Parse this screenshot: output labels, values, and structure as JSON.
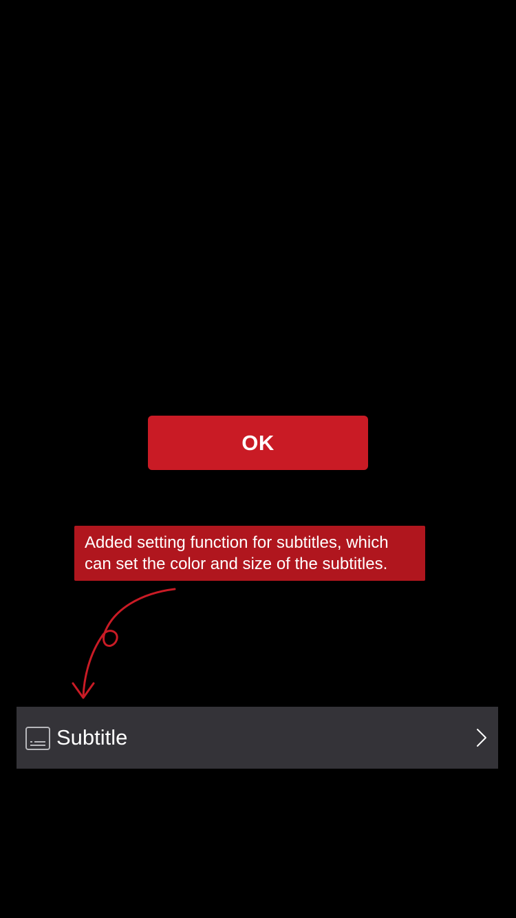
{
  "dialog": {
    "ok_label": "OK"
  },
  "callout": {
    "line1": "Added setting function for subtitles, which",
    "line2": "can set the color and size of the subtitles."
  },
  "settings_row": {
    "label": "Subtitle",
    "icon": "subtitle-icon",
    "trailing_icon": "chevron-right-icon"
  },
  "colors": {
    "background": "#000000",
    "accent_red": "#c91b25",
    "callout_red": "#b0161e",
    "row_background": "#343338",
    "text": "#ffffff"
  }
}
